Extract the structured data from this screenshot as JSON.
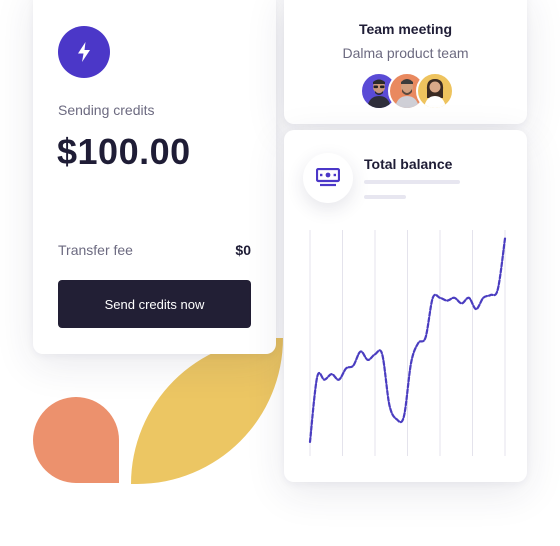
{
  "credits": {
    "label": "Sending credits",
    "amount": "$100.00",
    "fee_label": "Transfer fee",
    "fee_value": "$0",
    "button_label": "Send credits now",
    "icon": "lightning-bolt-icon",
    "accent": "#4b37c8",
    "button_color": "#221f35"
  },
  "meeting": {
    "title": "Team meeting",
    "subtitle": "Dalma product team",
    "avatars": [
      {
        "name": "avatar-man-glasses",
        "bg": "#5a4bd6"
      },
      {
        "name": "avatar-man-beard",
        "bg": "#e9895f"
      },
      {
        "name": "avatar-woman",
        "bg": "#eec35e"
      }
    ]
  },
  "balance": {
    "title": "Total balance",
    "icon": "money-icon",
    "line_color": "#4a3dc0"
  },
  "chart_data": {
    "type": "line",
    "title": "Total balance",
    "grid": true,
    "series": [
      {
        "values": [
          5,
          28,
          27,
          29,
          27,
          31,
          32,
          37,
          34,
          36,
          36,
          18,
          13,
          14,
          33,
          40,
          42,
          56,
          56,
          55,
          56,
          54,
          56,
          52,
          56,
          57,
          59,
          77
        ]
      }
    ],
    "ylim": [
      0,
      80
    ]
  },
  "colors": {
    "salmon": "#ec916d",
    "yellow": "#ecc663"
  }
}
